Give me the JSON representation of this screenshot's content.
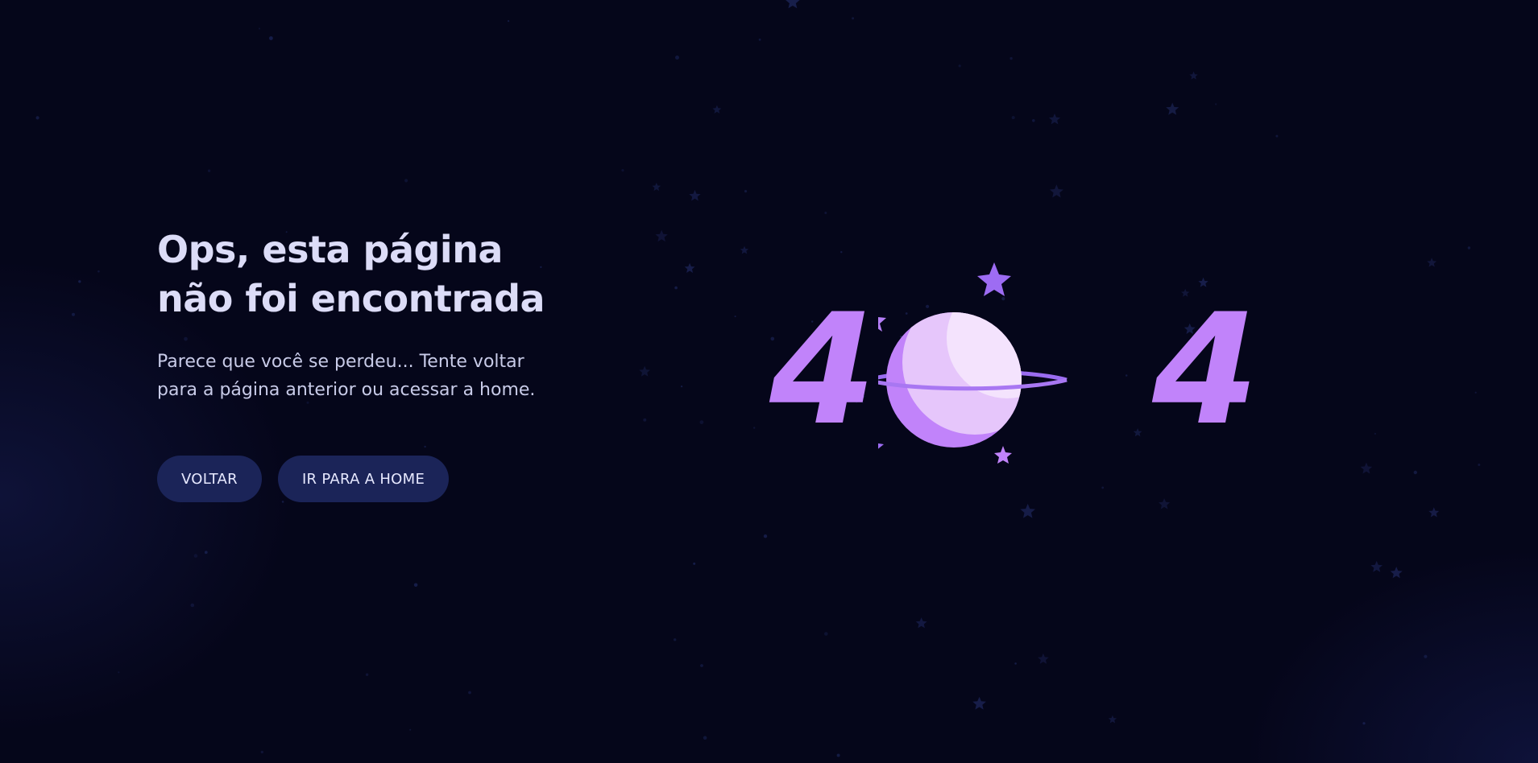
{
  "page": {
    "heading_line1": "Ops, esta página",
    "heading_line2": "não foi encontrada",
    "description_line1": "Parece que você se perdeu... Tente voltar",
    "description_line2": "para a página anterior ou acessar a home."
  },
  "buttons": {
    "back_label": "VOLTAR",
    "home_label": "IR PARA A HOME"
  },
  "illustration": {
    "digit_left": "4",
    "digit_right": "4",
    "planet_icon": "planet-icon",
    "star_icon": "star-icon"
  },
  "colors": {
    "background": "#05061a",
    "accent": "#c183fa",
    "button": "#1b2458",
    "text": "#dcdcf7"
  }
}
